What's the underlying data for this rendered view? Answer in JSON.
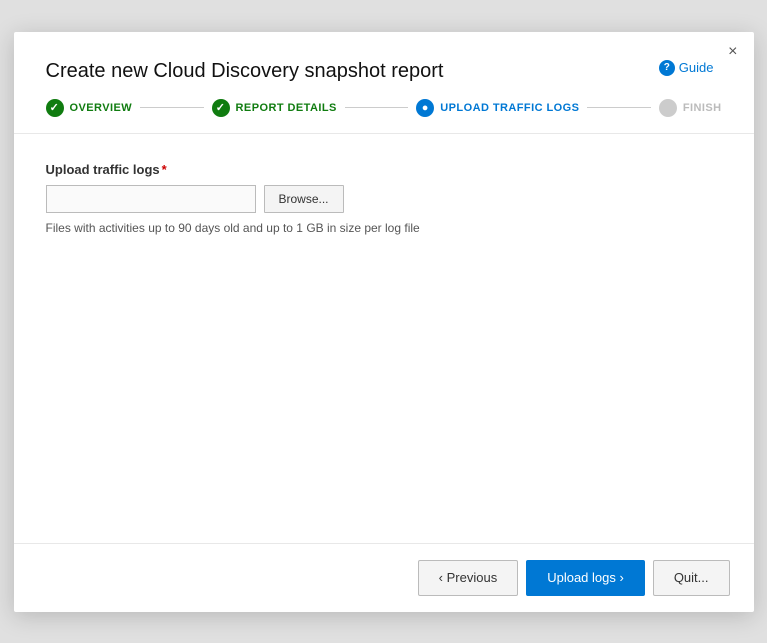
{
  "dialog": {
    "title": "Create new Cloud Discovery snapshot report",
    "close_label": "×",
    "guide_label": "Guide"
  },
  "stepper": {
    "steps": [
      {
        "id": "overview",
        "label": "OVERVIEW",
        "state": "completed"
      },
      {
        "id": "report-details",
        "label": "REPORT DETAILS",
        "state": "completed"
      },
      {
        "id": "upload-traffic-logs",
        "label": "UPLOAD TRAFFIC LOGS",
        "state": "active"
      },
      {
        "id": "finish",
        "label": "FINISH",
        "state": "inactive"
      }
    ]
  },
  "form": {
    "field_label": "Upload traffic logs",
    "required_marker": "*",
    "file_input_placeholder": "",
    "browse_button_label": "Browse...",
    "hint_text": "Files with activities up to 90 days old and up to 1 GB in size per log file"
  },
  "footer": {
    "previous_label": "‹ Previous",
    "upload_label": "Upload logs ›",
    "quit_label": "Quit..."
  }
}
